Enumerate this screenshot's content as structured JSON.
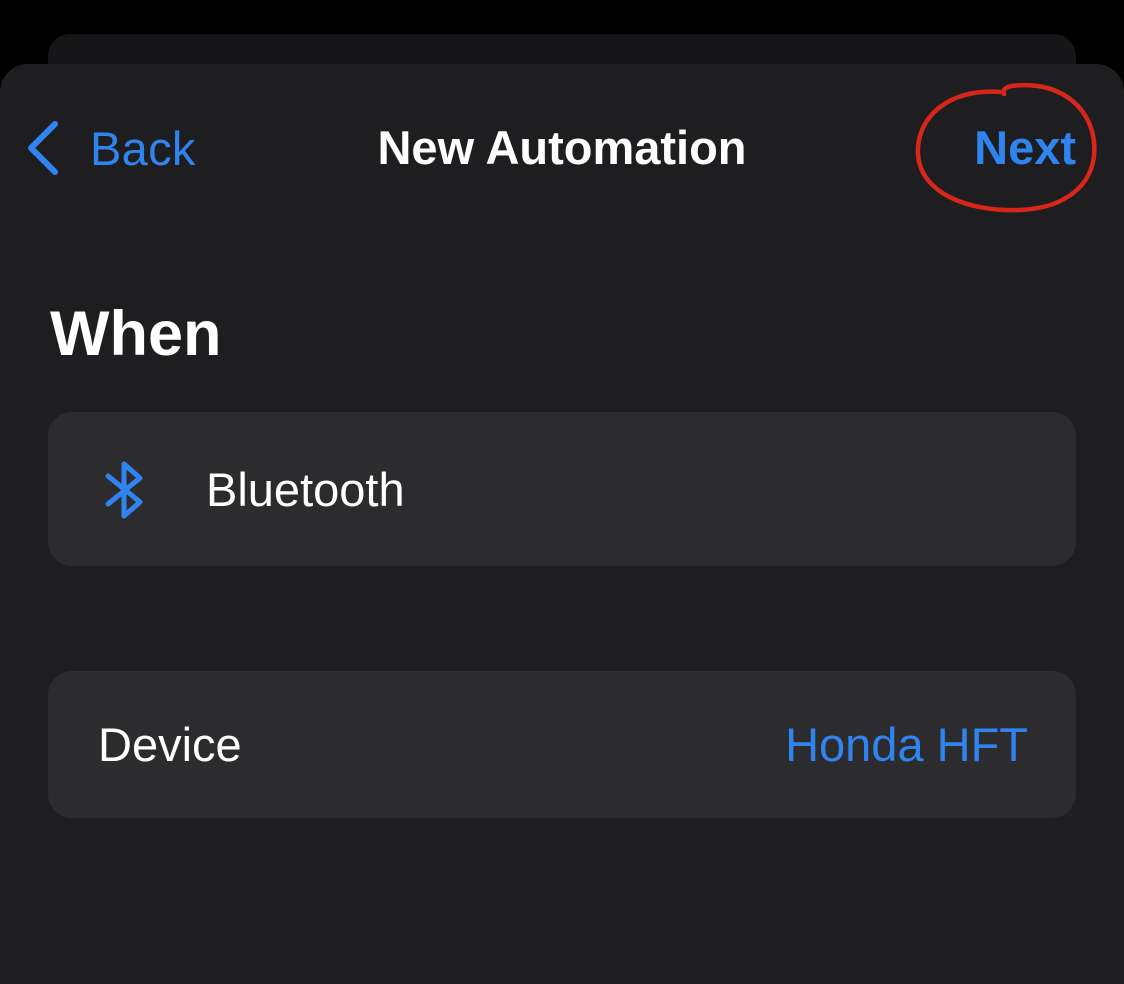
{
  "nav": {
    "back_label": "Back",
    "title": "New Automation",
    "next_label": "Next"
  },
  "section": {
    "heading": "When"
  },
  "trigger": {
    "icon": "bluetooth-icon",
    "label": "Bluetooth"
  },
  "device": {
    "label": "Device",
    "value": "Honda HFT"
  },
  "colors": {
    "accent": "#2f84f0",
    "sheet_background": "#1e1e20",
    "card_background": "#2c2c2e",
    "annotation": "#d8261b"
  }
}
